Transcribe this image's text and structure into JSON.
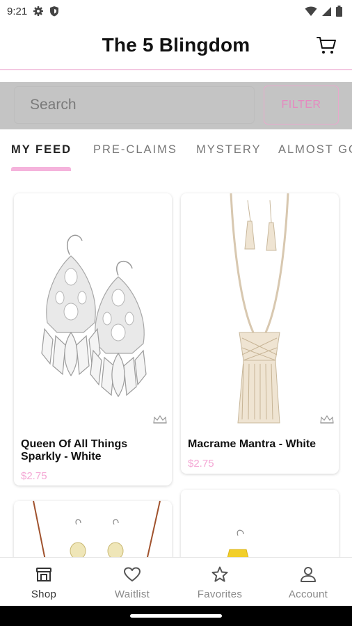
{
  "status_bar": {
    "time": "9:21"
  },
  "header": {
    "title": "The 5 Blingdom"
  },
  "search": {
    "placeholder": "Search",
    "filter_label": "FILTER"
  },
  "tabs": [
    {
      "label": "MY FEED",
      "active": true
    },
    {
      "label": "PRE-CLAIMS",
      "active": false
    },
    {
      "label": "MYSTERY",
      "active": false
    },
    {
      "label": "ALMOST GONE",
      "active": false
    }
  ],
  "products": [
    {
      "name": "Queen Of All Things Sparkly - White",
      "price": "$2.75"
    },
    {
      "name": "Macrame Mantra - White",
      "price": "$2.75"
    }
  ],
  "bottom_nav": [
    {
      "label": "Shop",
      "icon": "shop-icon",
      "active": true
    },
    {
      "label": "Waitlist",
      "icon": "heart-icon",
      "active": false
    },
    {
      "label": "Favorites",
      "icon": "star-icon",
      "active": false
    },
    {
      "label": "Account",
      "icon": "person-icon",
      "active": false
    }
  ],
  "colors": {
    "accent_pink": "#f5b3dc",
    "price_pink": "#f4a6d4",
    "filter_pink": "#e58ac0"
  }
}
